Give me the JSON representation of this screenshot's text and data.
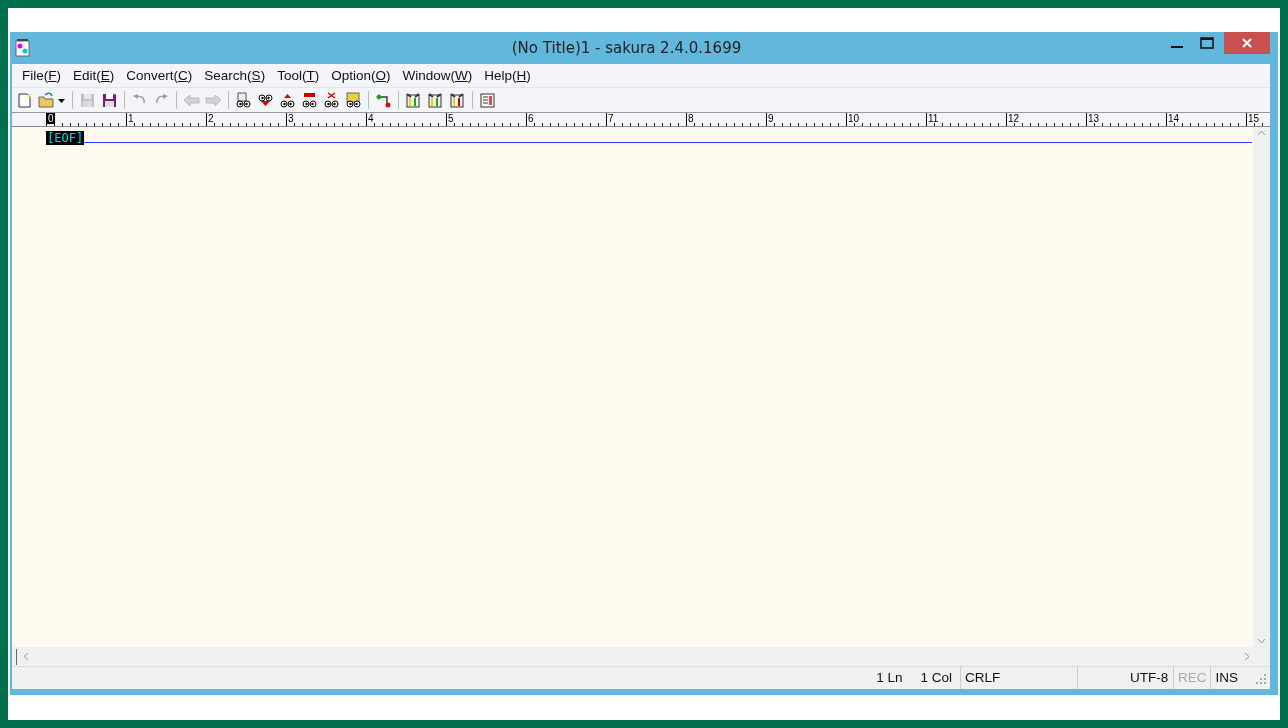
{
  "window": {
    "title": "(No Title)1 - sakura 2.4.0.1699"
  },
  "menu": [
    {
      "label": "File",
      "accelerator": "(F)"
    },
    {
      "label": "Edit",
      "accelerator": "(E)"
    },
    {
      "label": "Convert",
      "accelerator": "(C)"
    },
    {
      "label": "Search",
      "accelerator": "(S)"
    },
    {
      "label": "Tool",
      "accelerator": "(T)"
    },
    {
      "label": "Option",
      "accelerator": "(O)"
    },
    {
      "label": "Window",
      "accelerator": "(W)"
    },
    {
      "label": "Help",
      "accelerator": "(H)"
    }
  ],
  "toolbar": [
    {
      "kind": "new",
      "disabled": false
    },
    {
      "kind": "open",
      "disabled": false
    },
    {
      "kind": "sep"
    },
    {
      "kind": "save",
      "disabled": true
    },
    {
      "kind": "saveall",
      "disabled": false
    },
    {
      "kind": "sep"
    },
    {
      "kind": "undo",
      "disabled": true
    },
    {
      "kind": "redo",
      "disabled": true
    },
    {
      "kind": "sep"
    },
    {
      "kind": "back",
      "disabled": true
    },
    {
      "kind": "forward",
      "disabled": true
    },
    {
      "kind": "sep"
    },
    {
      "kind": "find",
      "disabled": false
    },
    {
      "kind": "finddown",
      "disabled": false
    },
    {
      "kind": "findup",
      "disabled": false
    },
    {
      "kind": "replace",
      "disabled": false
    },
    {
      "kind": "clear",
      "disabled": false
    },
    {
      "kind": "grep",
      "disabled": false
    },
    {
      "kind": "sep"
    },
    {
      "kind": "outline",
      "disabled": false
    },
    {
      "kind": "sep"
    },
    {
      "kind": "settings",
      "disabled": false
    },
    {
      "kind": "typesettings",
      "disabled": false
    },
    {
      "kind": "plugins",
      "disabled": false
    },
    {
      "kind": "sep"
    },
    {
      "kind": "list",
      "disabled": false
    }
  ],
  "ruler": [
    "0",
    "1",
    "2",
    "3",
    "4",
    "5",
    "6",
    "7",
    "8",
    "9",
    "10",
    "11",
    "12",
    "13",
    "14",
    "15"
  ],
  "editor": {
    "eof": "[EOF]"
  },
  "status_bar": [
    {
      "text": "1 Ln",
      "disabled": false
    },
    {
      "text": "1 Col",
      "disabled": false
    },
    {
      "text": "CRLF",
      "disabled": false
    },
    {
      "text": "UTF-8",
      "disabled": false
    },
    {
      "text": "REC",
      "disabled": true
    },
    {
      "text": "INS",
      "disabled": false
    }
  ]
}
